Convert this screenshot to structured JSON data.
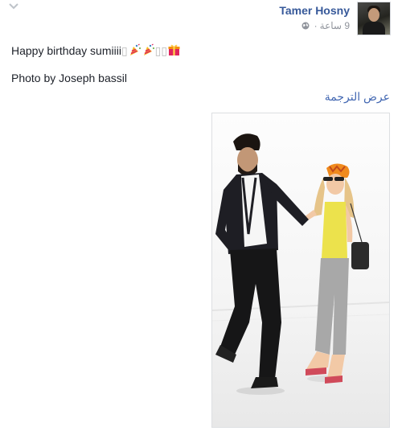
{
  "post": {
    "author": "Tamer Hosny",
    "time": "9 ساعة",
    "separator": "·",
    "text_line1": "Happy birthday sumiiii",
    "text_line2": "Photo by Joseph bassil",
    "translate_link": "عرض الترجمة"
  },
  "icons": {
    "menu": "chevron-down-icon",
    "privacy": "globe-icon",
    "emojis": [
      "party-popper-icon",
      "party-popper-icon",
      "gift-icon"
    ]
  },
  "colors": {
    "author": "#365899",
    "link": "#4267b2",
    "meta": "#90949c"
  }
}
